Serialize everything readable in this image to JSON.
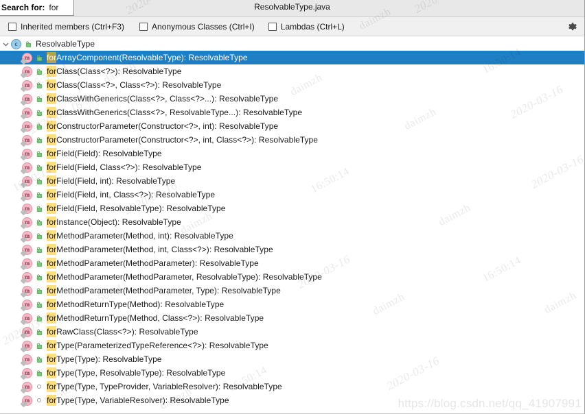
{
  "window": {
    "file_title": "ResolvableType.java"
  },
  "search": {
    "label": "Search for:",
    "value": "for",
    "placeholder": ""
  },
  "options": [
    {
      "label": "Inherited members (Ctrl+F3)",
      "checked": false,
      "name": "inherited-members"
    },
    {
      "label": "Anonymous Classes (Ctrl+I)",
      "checked": false,
      "name": "anonymous-classes"
    },
    {
      "label": "Lambdas (Ctrl+L)",
      "checked": false,
      "name": "lambdas"
    }
  ],
  "toolbar": {
    "settings_icon": "gear-icon"
  },
  "colors": {
    "selection": "#1f7fc4",
    "match_highlight": "#ffdf7e",
    "method_icon": "#f6b9c6",
    "class_icon": "#9ccbe8",
    "static_lock": "#7ec87e"
  },
  "tree": {
    "root": {
      "expanded": true,
      "icon": "class-icon",
      "modifier": "static-lock-icon",
      "label": "ResolvableType"
    },
    "members": [
      {
        "match": "for",
        "rest": "ArrayComponent(ResolvableType): ResolvableType",
        "modifier": "static-lock-icon",
        "selected": true
      },
      {
        "match": "for",
        "rest": "Class(Class<?>): ResolvableType",
        "modifier": "static-lock-icon",
        "selected": false
      },
      {
        "match": "for",
        "rest": "Class(Class<?>, Class<?>): ResolvableType",
        "modifier": "static-lock-icon",
        "selected": false
      },
      {
        "match": "for",
        "rest": "ClassWithGenerics(Class<?>, Class<?>...): ResolvableType",
        "modifier": "static-lock-icon",
        "selected": false
      },
      {
        "match": "for",
        "rest": "ClassWithGenerics(Class<?>, ResolvableType...): ResolvableType",
        "modifier": "static-lock-icon",
        "selected": false
      },
      {
        "match": "for",
        "rest": "ConstructorParameter(Constructor<?>, int): ResolvableType",
        "modifier": "static-lock-icon",
        "selected": false
      },
      {
        "match": "for",
        "rest": "ConstructorParameter(Constructor<?>, int, Class<?>): ResolvableType",
        "modifier": "static-lock-icon",
        "selected": false
      },
      {
        "match": "for",
        "rest": "Field(Field): ResolvableType",
        "modifier": "static-lock-icon",
        "selected": false
      },
      {
        "match": "for",
        "rest": "Field(Field, Class<?>): ResolvableType",
        "modifier": "static-lock-icon",
        "selected": false
      },
      {
        "match": "for",
        "rest": "Field(Field, int): ResolvableType",
        "modifier": "static-lock-icon",
        "selected": false
      },
      {
        "match": "for",
        "rest": "Field(Field, int, Class<?>): ResolvableType",
        "modifier": "static-lock-icon",
        "selected": false
      },
      {
        "match": "for",
        "rest": "Field(Field, ResolvableType): ResolvableType",
        "modifier": "static-lock-icon",
        "selected": false
      },
      {
        "match": "for",
        "rest": "Instance(Object): ResolvableType",
        "modifier": "static-lock-icon",
        "selected": false
      },
      {
        "match": "for",
        "rest": "MethodParameter(Method, int): ResolvableType",
        "modifier": "static-lock-icon",
        "selected": false
      },
      {
        "match": "for",
        "rest": "MethodParameter(Method, int, Class<?>): ResolvableType",
        "modifier": "static-lock-icon",
        "selected": false
      },
      {
        "match": "for",
        "rest": "MethodParameter(MethodParameter): ResolvableType",
        "modifier": "static-lock-icon",
        "selected": false
      },
      {
        "match": "for",
        "rest": "MethodParameter(MethodParameter, ResolvableType): ResolvableType",
        "modifier": "static-lock-icon",
        "selected": false
      },
      {
        "match": "for",
        "rest": "MethodParameter(MethodParameter, Type): ResolvableType",
        "modifier": "static-lock-icon",
        "selected": false
      },
      {
        "match": "for",
        "rest": "MethodReturnType(Method): ResolvableType",
        "modifier": "static-lock-icon",
        "selected": false
      },
      {
        "match": "for",
        "rest": "MethodReturnType(Method, Class<?>): ResolvableType",
        "modifier": "static-lock-icon",
        "selected": false
      },
      {
        "match": "for",
        "rest": "RawClass(Class<?>): ResolvableType",
        "modifier": "static-lock-icon",
        "selected": false
      },
      {
        "match": "for",
        "rest": "Type(ParameterizedTypeReference<?>): ResolvableType",
        "modifier": "static-lock-icon",
        "selected": false
      },
      {
        "match": "for",
        "rest": "Type(Type): ResolvableType",
        "modifier": "static-lock-icon",
        "selected": false
      },
      {
        "match": "for",
        "rest": "Type(Type, ResolvableType): ResolvableType",
        "modifier": "static-lock-icon",
        "selected": false
      },
      {
        "match": "for",
        "rest": "Type(Type, TypeProvider, VariableResolver): ResolvableType",
        "modifier": "package-private-icon",
        "selected": false
      },
      {
        "match": "for",
        "rest": "Type(Type, VariableResolver): ResolvableType",
        "modifier": "package-private-icon",
        "selected": false
      }
    ]
  },
  "watermarks": {
    "author": "daimzh",
    "date": "2020-03-16",
    "time": "16:50:14",
    "url": "https://blog.csdn.net/qq_41907991"
  }
}
